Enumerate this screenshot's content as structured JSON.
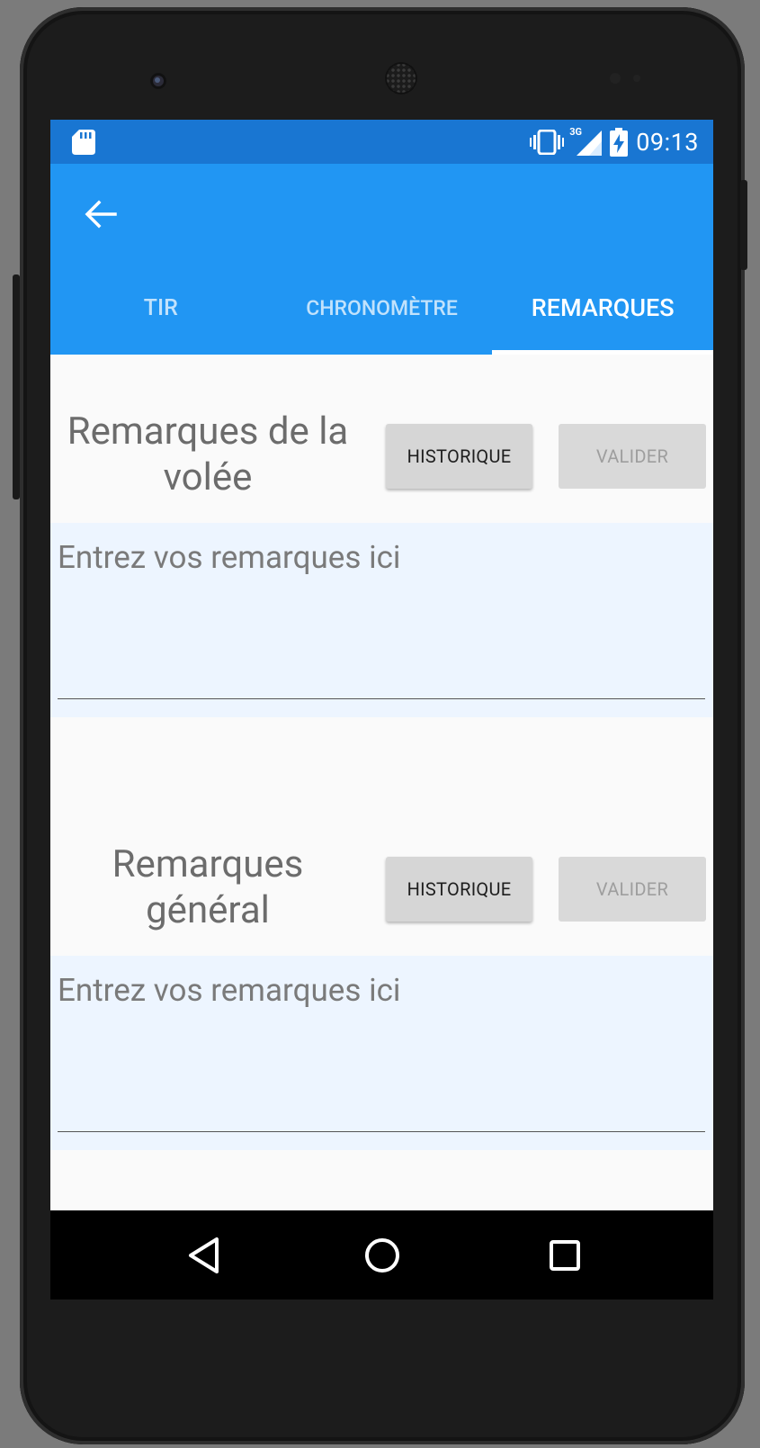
{
  "status": {
    "time": "09:13",
    "network": "3G"
  },
  "tabs": [
    {
      "label": "TIR"
    },
    {
      "label": "CHRONOMÈTRE"
    },
    {
      "label": "REMARQUES"
    }
  ],
  "active_tab": "REMARQUES",
  "sections": [
    {
      "title_line1": "Remarques de la",
      "title_line2": "volée",
      "history_label": "HISTORIQUE",
      "validate_label": "VALIDER",
      "placeholder": "Entrez vos remarques ici"
    },
    {
      "title_line1": "Remarques",
      "title_line2": "général",
      "history_label": "HISTORIQUE",
      "validate_label": "VALIDER",
      "placeholder": "Entrez vos remarques ici"
    }
  ],
  "colors": {
    "status_bar": "#1976d2",
    "app_bar": "#2196f3",
    "notes_bg": "#edf5ff"
  }
}
